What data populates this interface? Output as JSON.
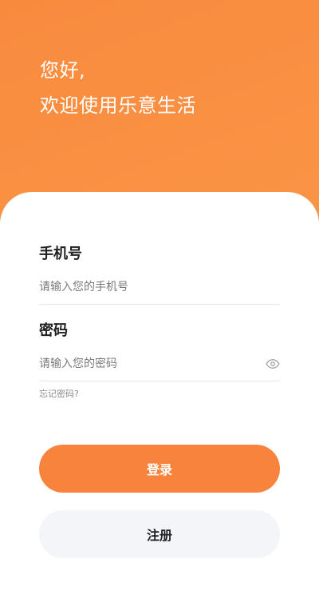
{
  "header": {
    "greeting_line1": "您好,",
    "greeting_line2": "欢迎使用乐意生活"
  },
  "form": {
    "phone": {
      "label": "手机号",
      "placeholder": "请输入您的手机号",
      "value": ""
    },
    "password": {
      "label": "密码",
      "placeholder": "请输入您的密码",
      "value": "",
      "toggle_icon": "eye-icon"
    },
    "forgot_label": "忘记密码?"
  },
  "actions": {
    "login_label": "登录",
    "register_label": "注册"
  },
  "colors": {
    "brand": "#f8833c",
    "gradient_start": "#f88a3e",
    "gradient_end": "#ffa958",
    "secondary_button_bg": "#f4f5f9",
    "divider": "#e6e6e6"
  }
}
